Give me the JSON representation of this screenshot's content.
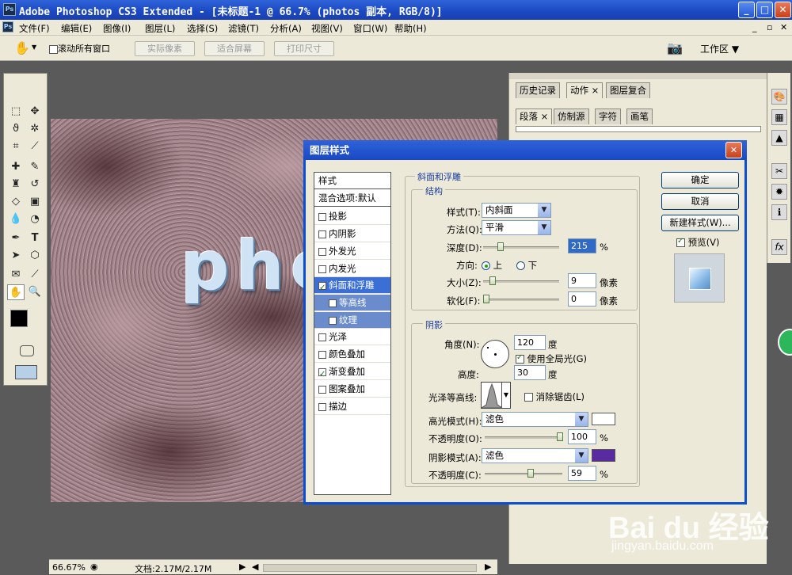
{
  "window": {
    "title": "Adobe Photoshop CS3 Extended - [未标题-1 @ 66.7% (photos 副本, RGB/8)]",
    "logo": "Ps"
  },
  "menu": [
    "文件(F)",
    "编辑(E)",
    "图像(I)",
    "图层(L)",
    "选择(S)",
    "滤镜(T)",
    "分析(A)",
    "视图(V)",
    "窗口(W)",
    "帮助(H)"
  ],
  "options": {
    "scroll_all": "滚动所有窗口",
    "actual_pixels": "实际像素",
    "fit_screen": "适合屏幕",
    "print_size": "打印尺寸",
    "workspace": "工作区"
  },
  "canvas": {
    "text": "phot"
  },
  "panels": {
    "group1": [
      "历史记录",
      "动作",
      "图层复合"
    ],
    "group2": [
      "段落",
      "仿制源",
      "字符",
      "画笔"
    ]
  },
  "status": {
    "zoom": "66.67%",
    "doc": "文档:2.17M/2.17M"
  },
  "dialog": {
    "title": "图层样式",
    "styles_header": "样式",
    "blend_options": "混合选项:默认",
    "styles": [
      {
        "label": "投影",
        "checked": false
      },
      {
        "label": "内阴影",
        "checked": false
      },
      {
        "label": "外发光",
        "checked": false
      },
      {
        "label": "内发光",
        "checked": false
      },
      {
        "label": "斜面和浮雕",
        "checked": true
      },
      {
        "label": "等高线",
        "checked": false
      },
      {
        "label": "纹理",
        "checked": false
      },
      {
        "label": "光泽",
        "checked": false
      },
      {
        "label": "颜色叠加",
        "checked": false
      },
      {
        "label": "渐变叠加",
        "checked": true
      },
      {
        "label": "图案叠加",
        "checked": false
      },
      {
        "label": "描边",
        "checked": false
      }
    ],
    "section_title": "斜面和浮雕",
    "structure": {
      "title": "结构",
      "style_label": "样式(T):",
      "style_value": "内斜面",
      "technique_label": "方法(Q):",
      "technique_value": "平滑",
      "depth_label": "深度(D):",
      "depth_value": "215",
      "depth_unit": "%",
      "direction_label": "方向:",
      "dir_up": "上",
      "dir_down": "下",
      "size_label": "大小(Z):",
      "size_value": "9",
      "size_unit": "像素",
      "soften_label": "软化(F):",
      "soften_value": "0",
      "soften_unit": "像素"
    },
    "shading": {
      "title": "阴影",
      "angle_label": "角度(N):",
      "angle_value": "120",
      "angle_unit": "度",
      "global_light": "使用全局光(G)",
      "altitude_label": "高度:",
      "altitude_value": "30",
      "altitude_unit": "度",
      "gloss_label": "光泽等高线:",
      "antialias": "消除锯齿(L)",
      "highlight_mode_label": "高光模式(H):",
      "highlight_mode": "滤色",
      "highlight_color": "#ffffff",
      "highlight_opacity_label": "不透明度(O):",
      "highlight_opacity": "100",
      "highlight_opacity_unit": "%",
      "shadow_mode_label": "阴影模式(A):",
      "shadow_mode": "滤色",
      "shadow_color": "#5a2aa0",
      "shadow_opacity_label": "不透明度(C):",
      "shadow_opacity": "59",
      "shadow_opacity_unit": "%"
    },
    "buttons": {
      "ok": "确定",
      "cancel": "取消",
      "new_style": "新建样式(W)...",
      "preview": "预览(V)"
    }
  },
  "watermark": {
    "logo": "Bai du 经验",
    "url": "jingyan.baidu.com"
  }
}
